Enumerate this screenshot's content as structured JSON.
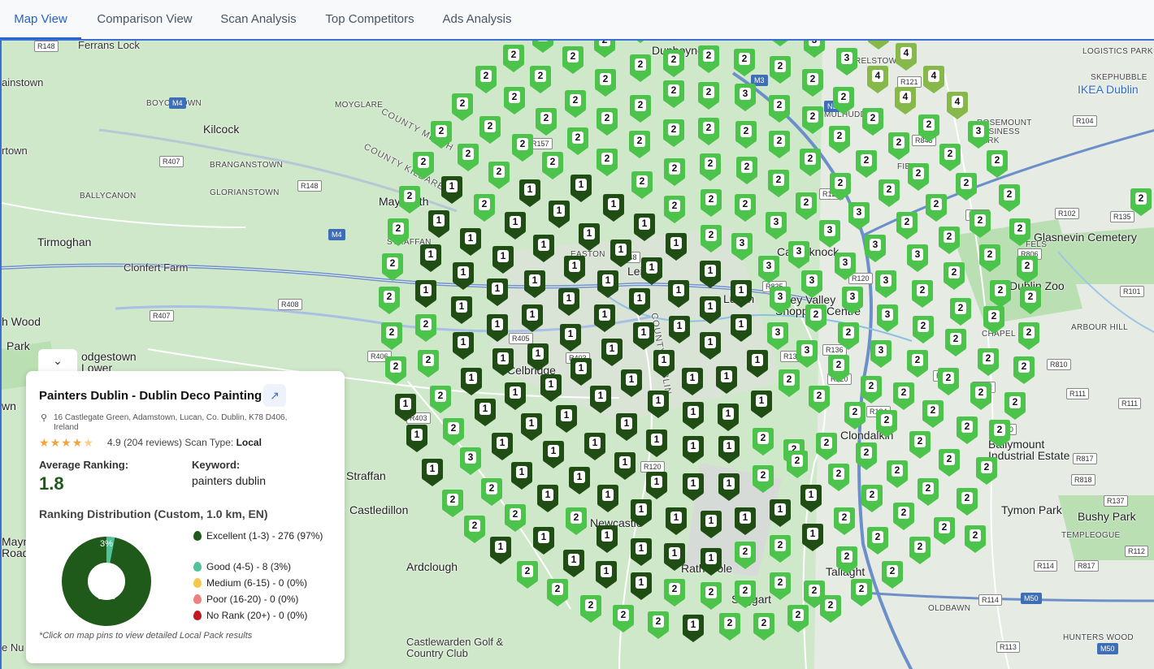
{
  "tabs": [
    {
      "label": "Map View",
      "active": true
    },
    {
      "label": "Comparison View",
      "active": false
    },
    {
      "label": "Scan Analysis",
      "active": false
    },
    {
      "label": "Top Competitors",
      "active": false
    },
    {
      "label": "Ads Analysis",
      "active": false
    }
  ],
  "map": {
    "places": [
      "Ferrans Lock",
      "ainstown",
      "BOYCETOWN",
      "Kilcock",
      "rtown",
      "BRANGANSTOWN",
      "BALLYCANON",
      "GLORIANSTOWN",
      "Tirmoghan",
      "Clonfert Farm",
      "STRAFFAN",
      "h Wood",
      "Park",
      "odgestown Lower",
      "wn",
      "Straffan",
      "Castledillon",
      "Mayno Road",
      "Ardclough",
      "Castlewarden Golf & Country Club",
      "e Nu",
      "Dunboyne",
      "MOYGLARE",
      "COUNTY MEATH",
      "COUNTY KILDARE",
      "Maynooth",
      "Celbridge",
      "Leixlip",
      "Lucan",
      "Newcastle",
      "Clondalkin",
      "Tallaght",
      "Saggart",
      "Rathcoole",
      "Castleknock",
      "Glasnevin Cemetery",
      "IKEA Dublin",
      "Dublin Zoo",
      "HUNTERS WOOD",
      "OLDBAWN",
      "TEMPLEOGUE",
      "Bushy Park",
      "ARBOUR HILL",
      "CHAPEL",
      "ROSEMOUNT BUSINESS PARK",
      "LOGISTICS PARK",
      "MULHUDD",
      "FIELDS",
      "EASTON",
      "COUNTY DUBLIN",
      "Liffey Valley Shopping Centre",
      "Ballymount Industrial Estate",
      "Tymon Park",
      "FELS",
      "RELSTOWN",
      "SKEPHUBBLE"
    ],
    "roads": [
      "R148",
      "M4",
      "R407",
      "R148",
      "M4",
      "R408",
      "R407",
      "R406",
      "R403",
      "R157",
      "R405",
      "R403",
      "M3",
      "N3",
      "R121",
      "R843",
      "R104",
      "R102",
      "R135",
      "R806",
      "R101",
      "R810",
      "R111",
      "R111",
      "R110",
      "R112",
      "R134",
      "R817",
      "R818",
      "R137",
      "R114",
      "R817",
      "R112",
      "M50",
      "R113",
      "R114",
      "M50",
      "R835",
      "R136",
      "R120",
      "R113",
      "R120",
      "R148",
      "R147",
      "R121",
      "R120",
      "R136"
    ]
  },
  "pins": {
    "levels": {
      "1": "#1f4d14",
      "2": "#4cc44c",
      "3": "#4cc44c",
      "4": "#86b84a",
      "5": "#86b84a"
    }
  },
  "panel": {
    "collapse_icon": "chevron-down",
    "business_name": "Painters Dublin - Dublin Deco Painting",
    "open_icon": "external-link",
    "address": "16 Castlegate Green, Adamstown, Lucan, Co. Dublin, K78 D406, Ireland",
    "rating_value": 4.5,
    "rating_text": "4.9 (204 reviews)",
    "scan_type_label": "Scan Type:",
    "scan_type_value": "Local",
    "avg_label": "Average Ranking:",
    "avg_value": "1.8",
    "keyword_label": "Keyword:",
    "keyword_value": "painters dublin",
    "distribution_title": "Ranking Distribution (Custom, 1.0 km, EN)",
    "donut": {
      "excellent_pct": 97,
      "good_pct": 3,
      "label_excellent": "97%",
      "label_good": "3%"
    },
    "legend": [
      {
        "label": "Excellent (1-3) - 276 (97%)",
        "color": "#1f5a1a"
      },
      {
        "label": "Good (4-5) - 8 (3%)",
        "color": "#4fc39a"
      },
      {
        "label": "Medium (6-15) - 0 (0%)",
        "color": "#f2c94c"
      },
      {
        "label": "Poor (16-20) - 0 (0%)",
        "color": "#f08080"
      },
      {
        "label": "No Rank (20+) - 0 (0%)",
        "color": "#c0191f"
      }
    ],
    "note": "*Click on map pins to view detailed Local Pack results"
  },
  "colors": {
    "accent": "#2563c9",
    "map_bg": "#cfe8c9"
  }
}
